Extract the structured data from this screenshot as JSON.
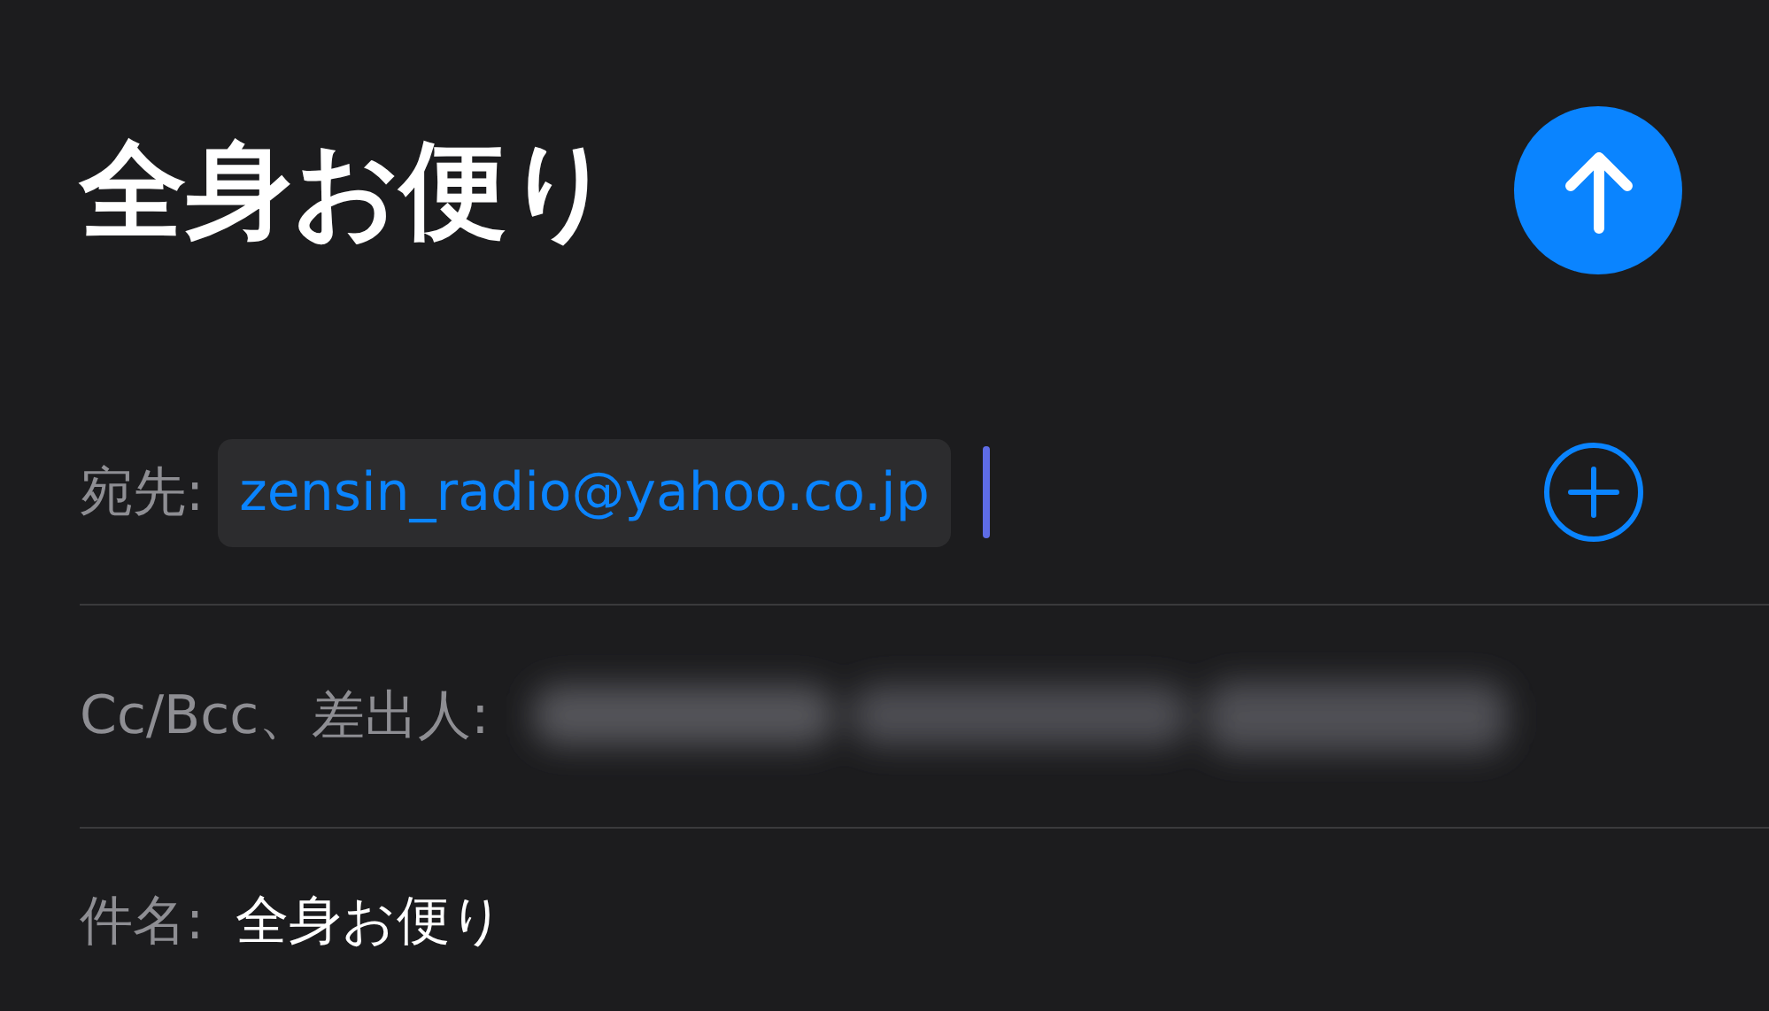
{
  "title": "全身お便り",
  "to": {
    "label": "宛先:",
    "recipients": [
      "zensin_radio@yahoo.co.jp"
    ]
  },
  "cc_from": {
    "label": "Cc/Bcc、差出人:"
  },
  "subject": {
    "label": "件名:",
    "value": "全身お便り"
  }
}
